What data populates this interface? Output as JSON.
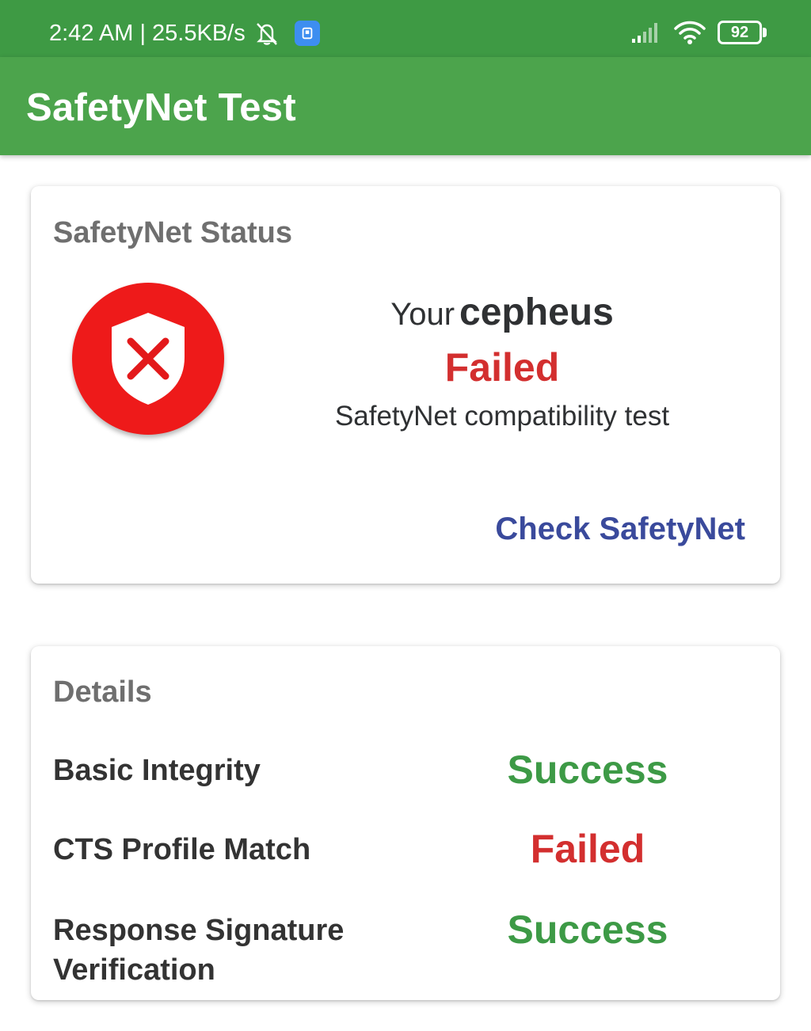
{
  "status_bar": {
    "time_speed": "2:42 AM | 25.5KB/s",
    "battery": "92"
  },
  "app_bar": {
    "title": "SafetyNet Test"
  },
  "status_card": {
    "title": "SafetyNet Status",
    "your": "Your",
    "device": "cepheus",
    "result": "Failed",
    "description": "SafetyNet compatibility test",
    "button": "Check SafetyNet",
    "icon": "shield-x-icon"
  },
  "details_card": {
    "title": "Details",
    "rows": [
      {
        "label": "Basic Integrity",
        "value": "Success"
      },
      {
        "label": "CTS Profile Match",
        "value": "Failed"
      },
      {
        "label": "Response Signature Verification",
        "value": "Success"
      }
    ]
  },
  "colors": {
    "status_bar": "#3e9a44",
    "app_bar": "#4ca44c",
    "success": "#3d9a46",
    "failed": "#d32f2f",
    "button": "#3a4a9c",
    "shield_bg": "#ee1a1a"
  }
}
